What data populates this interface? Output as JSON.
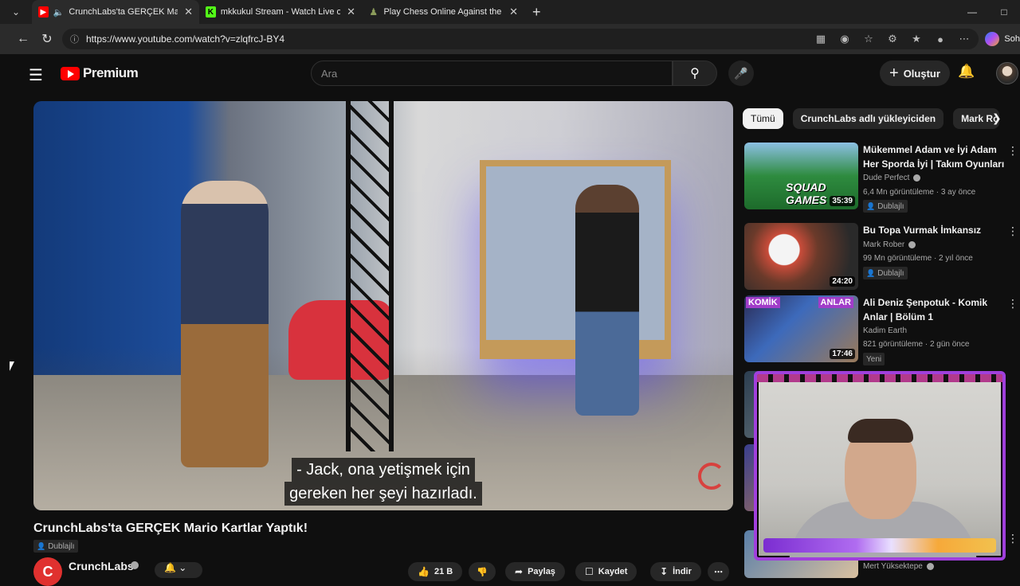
{
  "browser": {
    "tabs": [
      {
        "title": "CrunchLabs'ta GERÇEK Mario",
        "favicon_color": "#ff0000",
        "active": true
      },
      {
        "title": "mkkukul Stream - Watch Live on K",
        "favicon_color": "#53fc18",
        "active": false
      },
      {
        "title": "Play Chess Online Against the Com",
        "favicon_color": "#8b9b5a",
        "active": false
      }
    ],
    "url": "https://www.youtube.com/watch?v=zlqfrcJ-BY4",
    "copilot_label": "Soh"
  },
  "youtube": {
    "logo_text": "Premium",
    "search_placeholder": "Ara",
    "create_label": "Oluştur"
  },
  "video": {
    "subtitle_line1": "- Jack, ona yetişmek için",
    "subtitle_line2": "gereken her şeyi hazırladı.",
    "title": "CrunchLabs'ta GERÇEK Mario Kartlar Yaptık!",
    "dub_badge": "Dublajlı",
    "channel": "CrunchLabs",
    "like_count": "21 B",
    "share_label": "Paylaş",
    "save_label": "Kaydet",
    "download_label": "İndir"
  },
  "chips": [
    "Tümü",
    "CrunchLabs adlı yükleyiciden",
    "Mark Ro"
  ],
  "recommendations": [
    {
      "title": "Mükemmel Adam ve İyi Adam Her Sporda İyi | Takım Oyunları",
      "channel": "Dude Perfect",
      "meta": "6,4 Mn görüntüleme · 3 ay önce",
      "badge": "Dublajlı",
      "duration": "35:39",
      "thumb_text": "SQUAD GAMES"
    },
    {
      "title": "Bu Topa Vurmak İmkansız",
      "channel": "Mark Rober",
      "meta": "99 Mn görüntüleme · 2 yıl önce",
      "badge": "Dublajlı",
      "duration": "24:20"
    },
    {
      "title": "Ali Deniz Şenpotuk - Komik Anlar | Bölüm 1",
      "channel": "Kadim Earth",
      "meta": "821 görüntüleme · 2 gün önce",
      "badge": "Yeni",
      "duration": "17:46",
      "thumb_k": "KOMİK",
      "thumb_a": "ANLAR"
    }
  ],
  "peek_channel": "Mert Yüksektepe"
}
